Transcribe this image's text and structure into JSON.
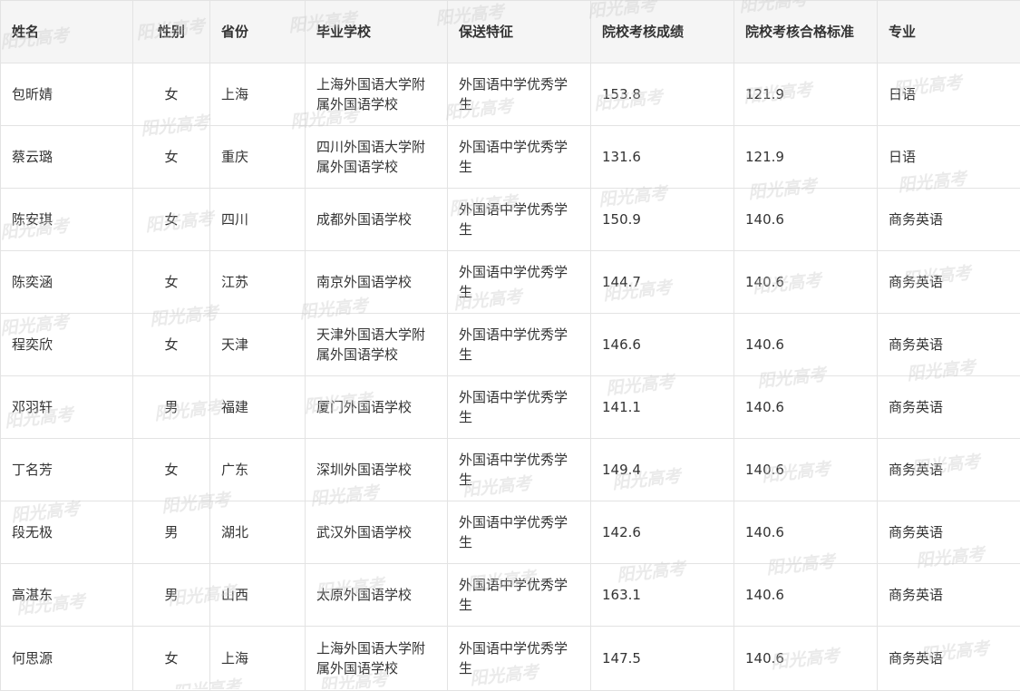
{
  "watermark_text": "阳光高考",
  "table": {
    "headers": {
      "name": "姓名",
      "gender": "性别",
      "province": "省份",
      "school": "毕业学校",
      "feature": "保送特征",
      "score": "院校考核成绩",
      "standard": "院校考核合格标准",
      "major": "专业"
    },
    "rows": [
      {
        "name": "包昕婧",
        "gender": "女",
        "province": "上海",
        "school": "上海外国语大学附属外国语学校",
        "feature": "外国语中学优秀学生",
        "score": "153.8",
        "standard": "121.9",
        "major": "日语"
      },
      {
        "name": "蔡云璐",
        "gender": "女",
        "province": "重庆",
        "school": "四川外国语大学附属外国语学校",
        "feature": "外国语中学优秀学生",
        "score": "131.6",
        "standard": "121.9",
        "major": "日语"
      },
      {
        "name": "陈安琪",
        "gender": "女",
        "province": "四川",
        "school": "成都外国语学校",
        "feature": "外国语中学优秀学生",
        "score": "150.9",
        "standard": "140.6",
        "major": "商务英语"
      },
      {
        "name": "陈奕涵",
        "gender": "女",
        "province": "江苏",
        "school": "南京外国语学校",
        "feature": "外国语中学优秀学生",
        "score": "144.7",
        "standard": "140.6",
        "major": "商务英语"
      },
      {
        "name": "程奕欣",
        "gender": "女",
        "province": "天津",
        "school": "天津外国语大学附属外国语学校",
        "feature": "外国语中学优秀学生",
        "score": "146.6",
        "standard": "140.6",
        "major": "商务英语"
      },
      {
        "name": "邓羽轩",
        "gender": "男",
        "province": "福建",
        "school": "厦门外国语学校",
        "feature": "外国语中学优秀学生",
        "score": "141.1",
        "standard": "140.6",
        "major": "商务英语"
      },
      {
        "name": "丁名芳",
        "gender": "女",
        "province": "广东",
        "school": "深圳外国语学校",
        "feature": "外国语中学优秀学生",
        "score": "149.4",
        "standard": "140.6",
        "major": "商务英语"
      },
      {
        "name": "段无极",
        "gender": "男",
        "province": "湖北",
        "school": "武汉外国语学校",
        "feature": "外国语中学优秀学生",
        "score": "142.6",
        "standard": "140.6",
        "major": "商务英语"
      },
      {
        "name": "高湛东",
        "gender": "男",
        "province": "山西",
        "school": "太原外国语学校",
        "feature": "外国语中学优秀学生",
        "score": "163.1",
        "standard": "140.6",
        "major": "商务英语"
      },
      {
        "name": "何思源",
        "gender": "女",
        "province": "上海",
        "school": "上海外国语大学附属外国语学校",
        "feature": "外国语中学优秀学生",
        "score": "147.5",
        "standard": "140.6",
        "major": "商务英语"
      }
    ]
  }
}
